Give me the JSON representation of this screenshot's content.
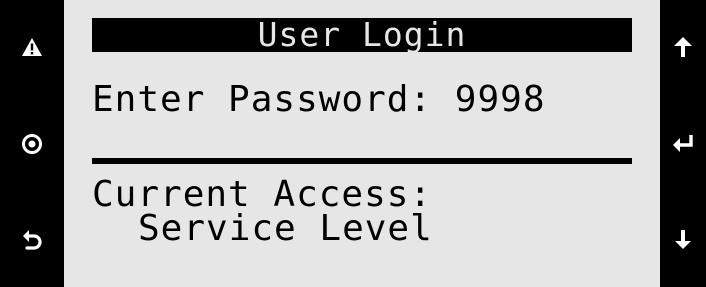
{
  "screen": {
    "title": "User Login",
    "password_label": "Enter Password:",
    "password_value": "9998",
    "access_label": "Current Access:",
    "access_value": "Service Level"
  },
  "buttons": {
    "left": [
      {
        "icon": "warning-icon"
      },
      {
        "icon": "record-icon"
      },
      {
        "icon": "back-icon"
      }
    ],
    "right": [
      {
        "icon": "arrow-up-icon"
      },
      {
        "icon": "enter-icon"
      },
      {
        "icon": "arrow-down-icon"
      }
    ]
  },
  "colors": {
    "lcd_background": "#e6e6e6",
    "frame": "#000000",
    "icon": "#ffffff"
  }
}
